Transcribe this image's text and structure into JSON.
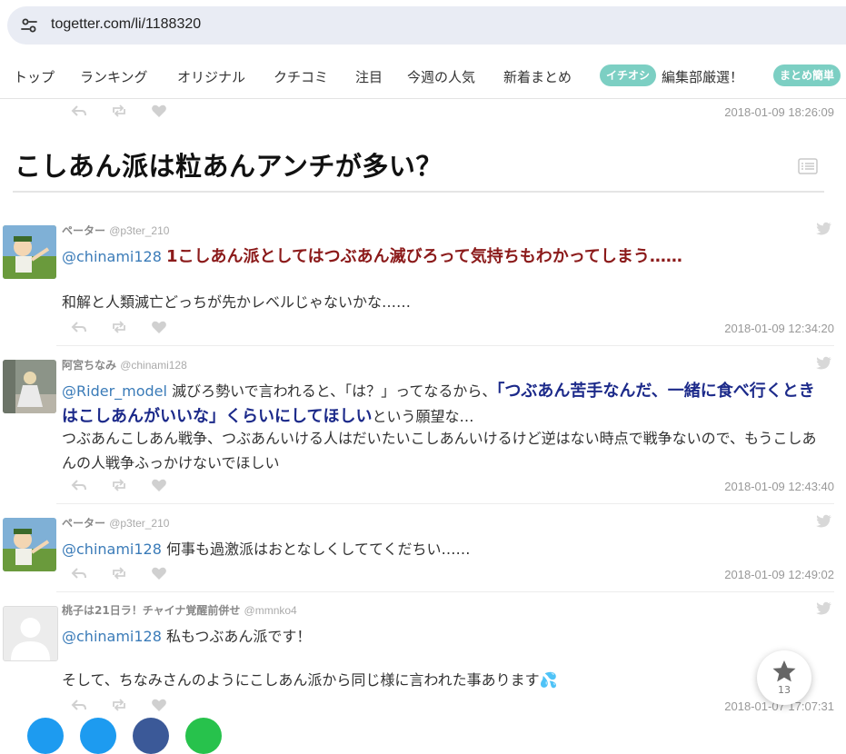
{
  "browser": {
    "url": "togetter.com/li/1188320"
  },
  "nav": {
    "items": [
      "トップ",
      "ランキング",
      "オリジナル",
      "クチコミ",
      "注目",
      "今週の人気",
      "新着まとめ"
    ],
    "pick_badge": "イチオシ",
    "pick_text": "編集部厳選！",
    "easy_badge": "まとめ簡単"
  },
  "top_timestamp": "2018-01-09 18:26:09",
  "section_title": "こしあん派は粒あんアンチが多い？",
  "tweets": [
    {
      "name": "ペーター",
      "handle": "@p3ter_210",
      "mention": "@chinami128",
      "highlight": "1こしあん派としてはつぶあん滅びろって気持ちもわかってしまう……",
      "text": "和解と人類滅亡どっちが先かレベルじゃないかな……",
      "timestamp": "2018-01-09 12:34:20"
    },
    {
      "name": "阿宮ちなみ",
      "handle": "@chinami128",
      "mention": "@Rider_model",
      "text_a": "滅びろ勢いで言われると、「は？」ってなるから、",
      "highlight": "「つぶあん苦手なんだ、一緒に食べ行くときはこしあんがいいな」くらいにしてほしい",
      "text_b": "という願望な…",
      "text_c": "つぶあんこしあん戦争、つぶあんいける人はだいたいこしあんいけるけど逆はない時点で戦争ないので、もうこしあんの人戦争ふっかけないでほしい",
      "timestamp": "2018-01-09 12:43:40"
    },
    {
      "name": "ペーター",
      "handle": "@p3ter_210",
      "mention": "@chinami128",
      "text": "何事も過激派はおとなしくしててくだちい……",
      "timestamp": "2018-01-09 12:49:02"
    },
    {
      "name": "桃子は21日ラ！チャイナ覚醒前併せ",
      "handle": "@mmnko4",
      "mention": "@chinami128",
      "text": "私もつぶあん派です！",
      "text2": "そして、ちなみさんのようにこしあん派から同じ様に言われた事あります💦",
      "timestamp": "2018-01-07 17:07:31"
    }
  ],
  "favorite": {
    "count": "13"
  },
  "colors": {
    "mention": "#3a7bb8",
    "red_highlight": "#8b1a1a",
    "navy_highlight": "#1c2a8a",
    "badge": "#7ccfc3"
  }
}
